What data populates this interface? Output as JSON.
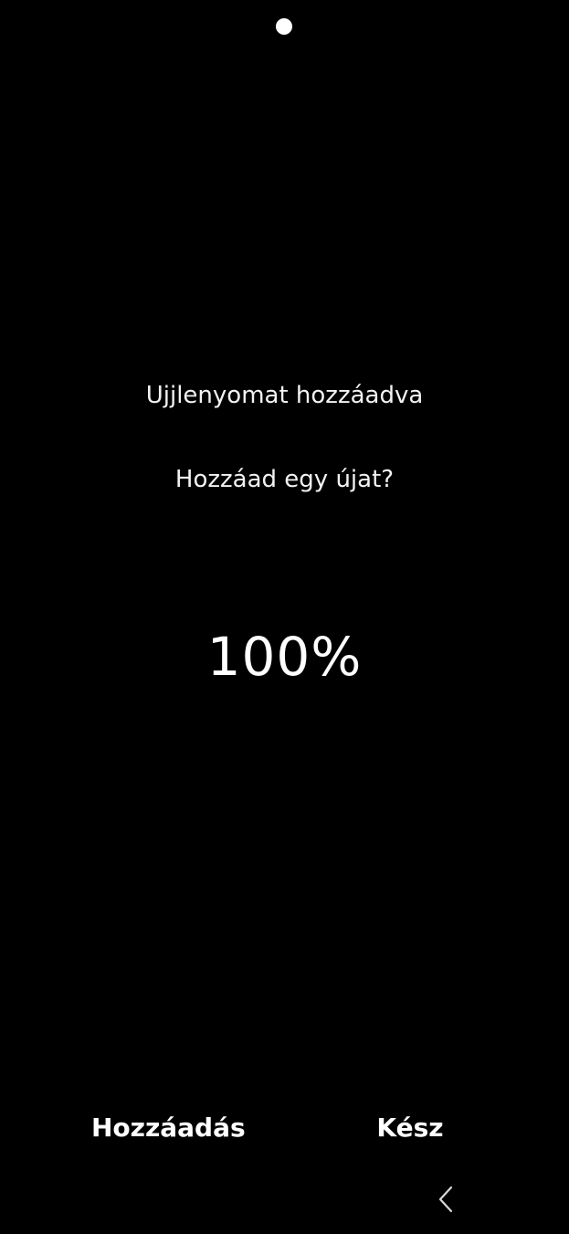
{
  "status_bar": {
    "camera_icon": "camera-cutout-dot"
  },
  "main": {
    "title": "Ujjlenyomat hozzáadva",
    "subtitle": "Hozzáad egy újat?",
    "progress_label": "100%",
    "progress_value": 100
  },
  "actions": {
    "add_label": "Hozzáadás",
    "done_label": "Kész"
  },
  "navigation": {
    "back_icon": "chevron-left-icon"
  },
  "colors": {
    "background": "#000000",
    "text": "#ffffff"
  }
}
